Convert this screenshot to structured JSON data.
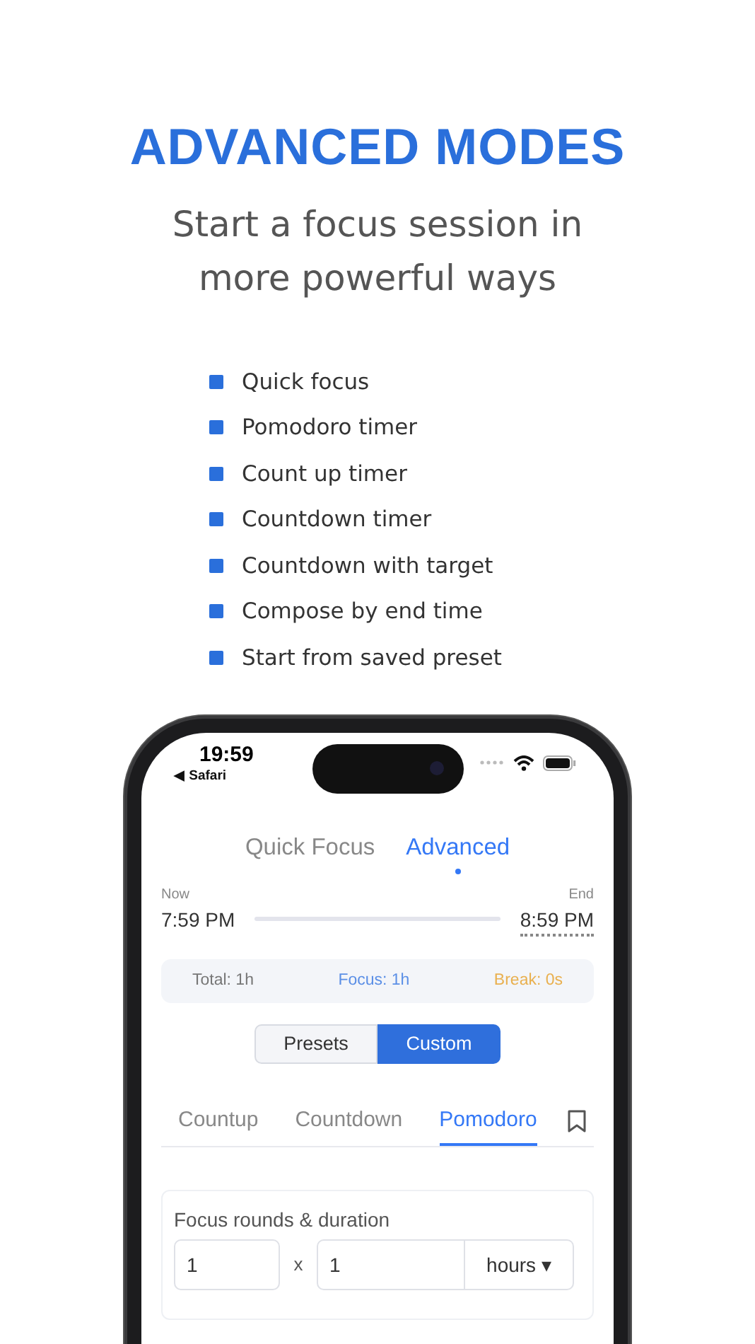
{
  "heading": "ADVANCED MODES",
  "subtitle": "Start a focus session in more powerful ways",
  "features": [
    "Quick focus",
    "Pomodoro timer",
    "Count up timer",
    "Countdown timer",
    "Countdown with target",
    "Compose by end time",
    "Start from saved preset"
  ],
  "status_bar": {
    "time": "19:59",
    "back_label": "◀ Safari"
  },
  "mode_tabs": [
    {
      "label": "Quick Focus",
      "selected": false
    },
    {
      "label": "Advanced",
      "selected": true
    }
  ],
  "timeline": {
    "start_label": "Now",
    "start_time": "7:59 PM",
    "end_label": "End",
    "end_time": "8:59 PM"
  },
  "summary": [
    {
      "kind": "total",
      "text": "Total: 1h"
    },
    {
      "kind": "focus",
      "text": "Focus: 1h"
    },
    {
      "kind": "break",
      "text": "Break: 0s"
    }
  ],
  "segments": [
    {
      "label": "Presets",
      "selected": false
    },
    {
      "label": "Custom",
      "selected": true
    }
  ],
  "timer_tabs": [
    {
      "label": "Countup",
      "selected": false
    },
    {
      "label": "Countdown",
      "selected": false
    },
    {
      "label": "Pomodoro",
      "selected": true
    }
  ],
  "focus_card": {
    "title": "Focus rounds & duration",
    "rounds": "1",
    "times_sign": "x",
    "duration": "1",
    "unit": "hours ▾"
  }
}
